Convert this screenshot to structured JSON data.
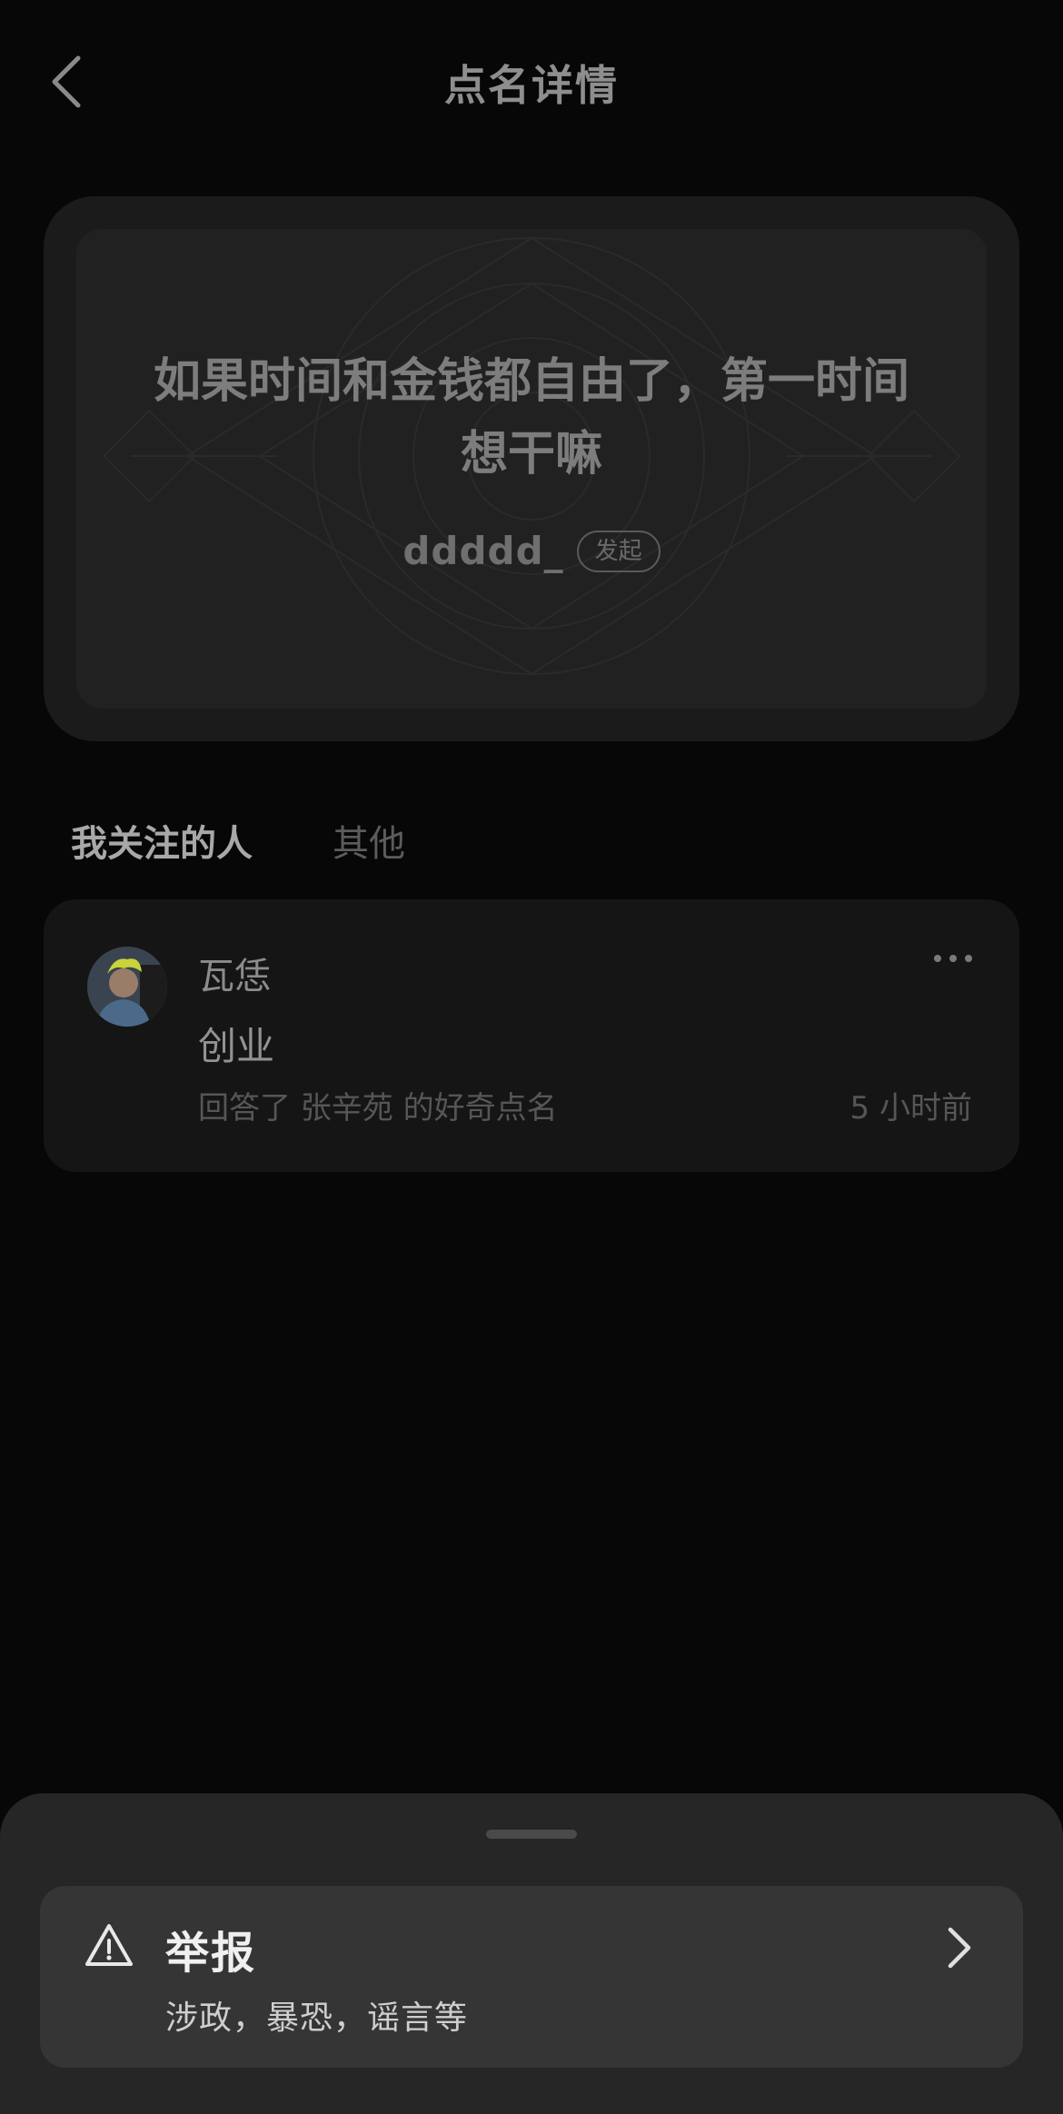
{
  "header": {
    "title": "点名详情"
  },
  "question_card": {
    "question": "如果时间和金钱都自由了，第一时间想干嘛",
    "author": "ddddd_",
    "badge": "发起"
  },
  "tabs": [
    {
      "label": "我关注的人",
      "active": true
    },
    {
      "label": "其他",
      "active": false
    }
  ],
  "answers": [
    {
      "user": "瓦恁",
      "text": "创业",
      "meta": "回答了 张辛苑 的好奇点名",
      "time": "5 小时前"
    }
  ],
  "sheet": {
    "report_title": "举报",
    "report_subtitle": "涉政，暴恐，谣言等"
  },
  "colors": {
    "background": "#070707",
    "card": "#1b1b1b",
    "sheet": "#262626",
    "report_row": "#353535"
  }
}
